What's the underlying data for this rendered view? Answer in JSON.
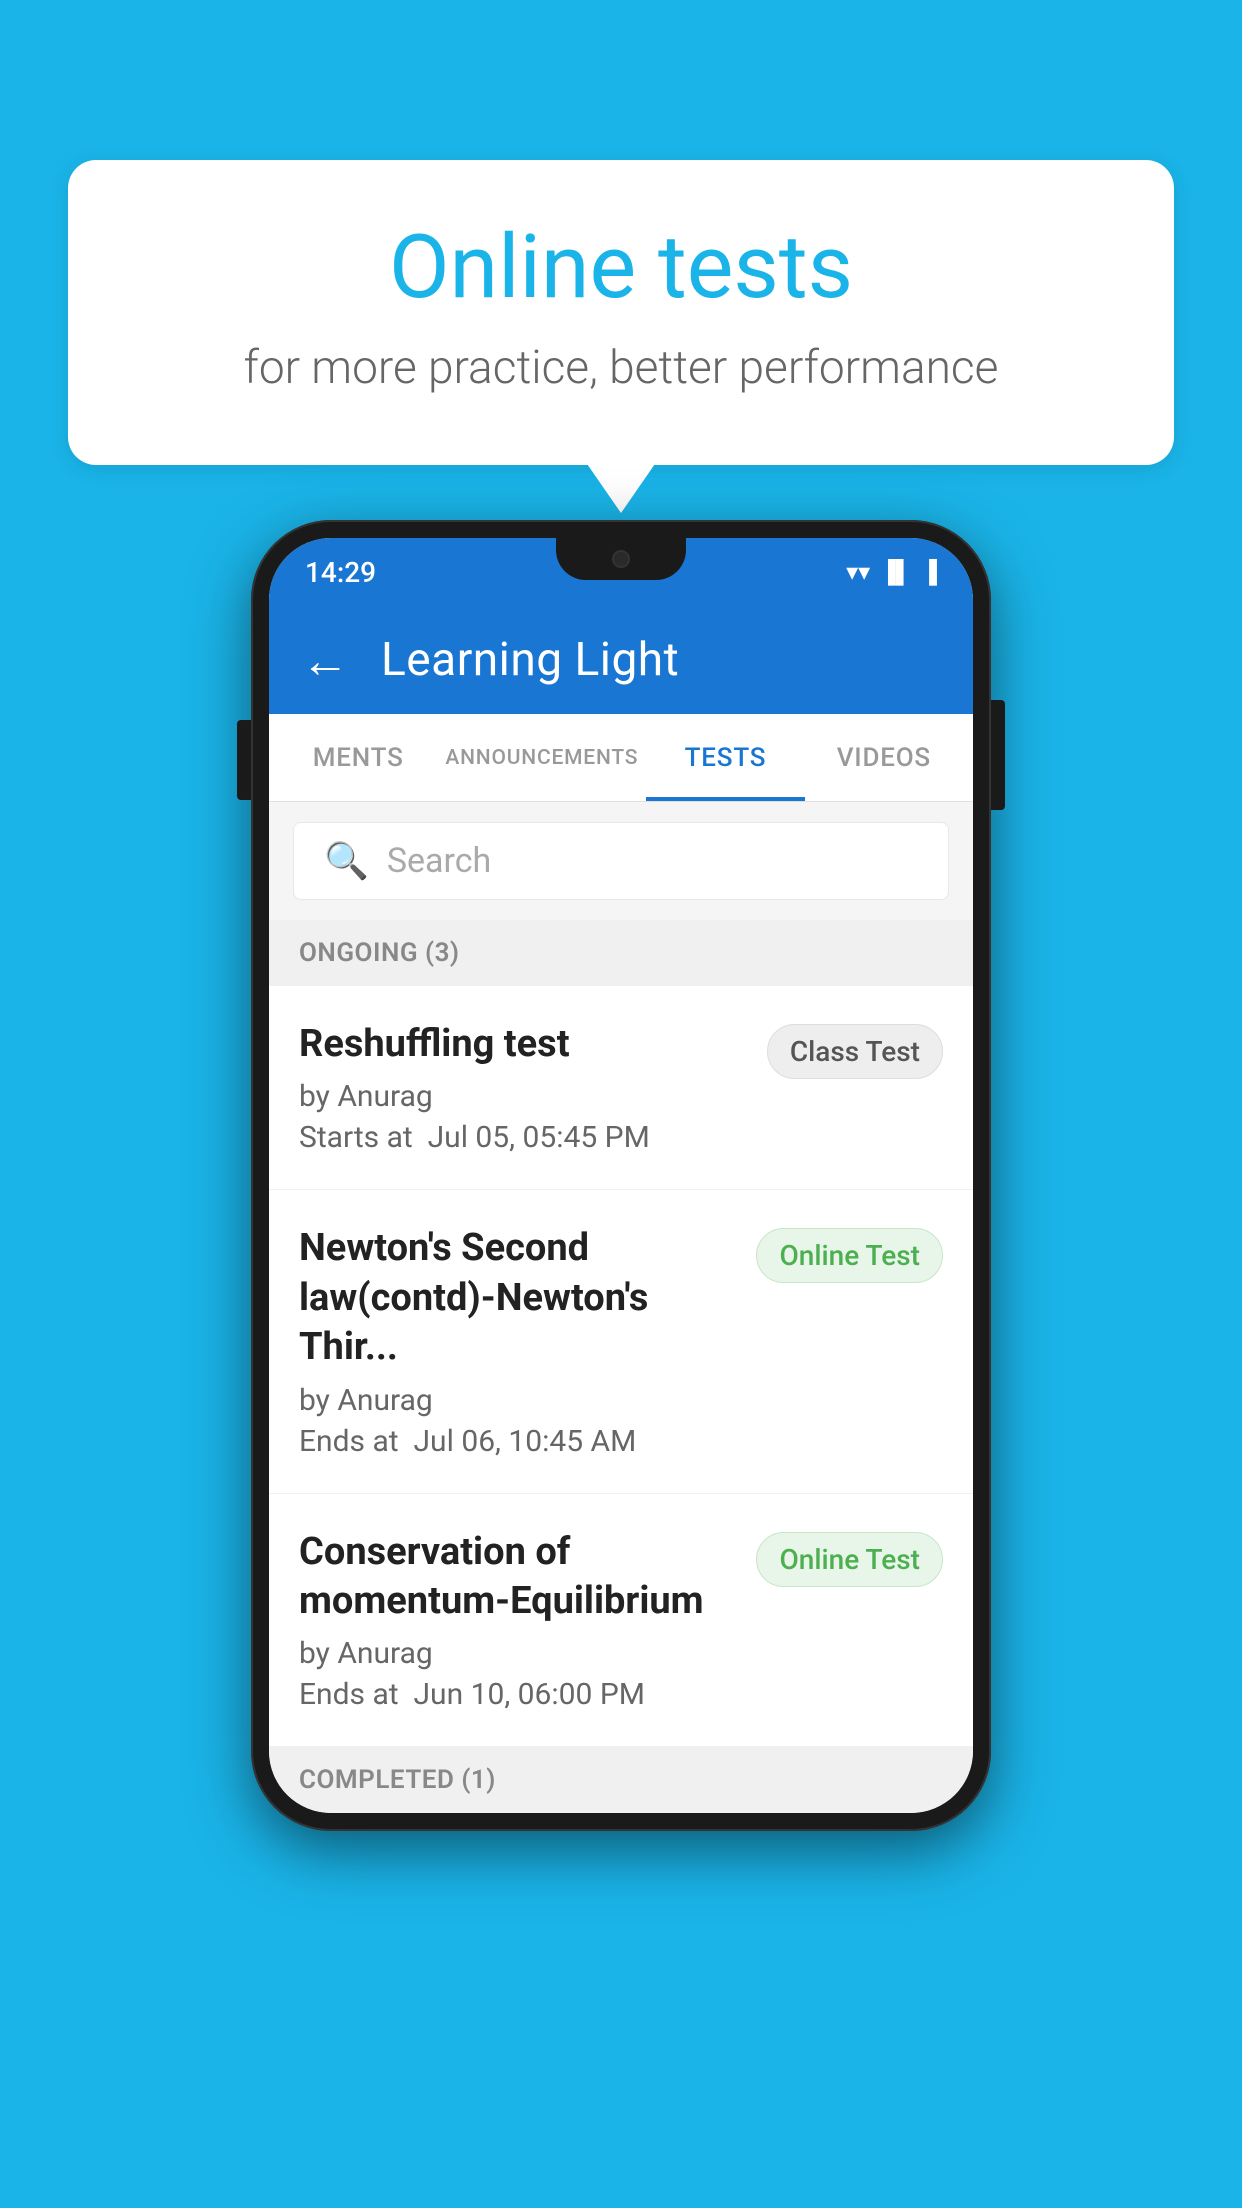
{
  "background_color": "#1ab4e8",
  "bubble": {
    "title": "Online tests",
    "subtitle": "for more practice, better performance"
  },
  "phone": {
    "status_bar": {
      "time": "14:29",
      "icons": [
        "wifi",
        "signal",
        "battery"
      ]
    },
    "app_bar": {
      "title": "Learning Light",
      "back_label": "←"
    },
    "tabs": [
      {
        "id": "ments",
        "label": "MENTS",
        "active": false
      },
      {
        "id": "announcements",
        "label": "ANNOUNCEMENTS",
        "active": false
      },
      {
        "id": "tests",
        "label": "TESTS",
        "active": true
      },
      {
        "id": "videos",
        "label": "VIDEOS",
        "active": false
      }
    ],
    "search": {
      "placeholder": "Search"
    },
    "ongoing_section": {
      "label": "ONGOING (3)"
    },
    "test_items": [
      {
        "id": "reshuffling",
        "name": "Reshuffling test",
        "author": "by Anurag",
        "time_label": "Starts at",
        "time_value": "Jul 05, 05:45 PM",
        "badge": "Class Test",
        "badge_type": "class"
      },
      {
        "id": "newtons-second",
        "name": "Newton's Second law(contd)-Newton's Thir...",
        "author": "by Anurag",
        "time_label": "Ends at",
        "time_value": "Jul 06, 10:45 AM",
        "badge": "Online Test",
        "badge_type": "online"
      },
      {
        "id": "conservation",
        "name": "Conservation of momentum-Equilibrium",
        "author": "by Anurag",
        "time_label": "Ends at",
        "time_value": "Jun 10, 06:00 PM",
        "badge": "Online Test",
        "badge_type": "online"
      }
    ],
    "completed_section": {
      "label": "COMPLETED (1)"
    }
  }
}
